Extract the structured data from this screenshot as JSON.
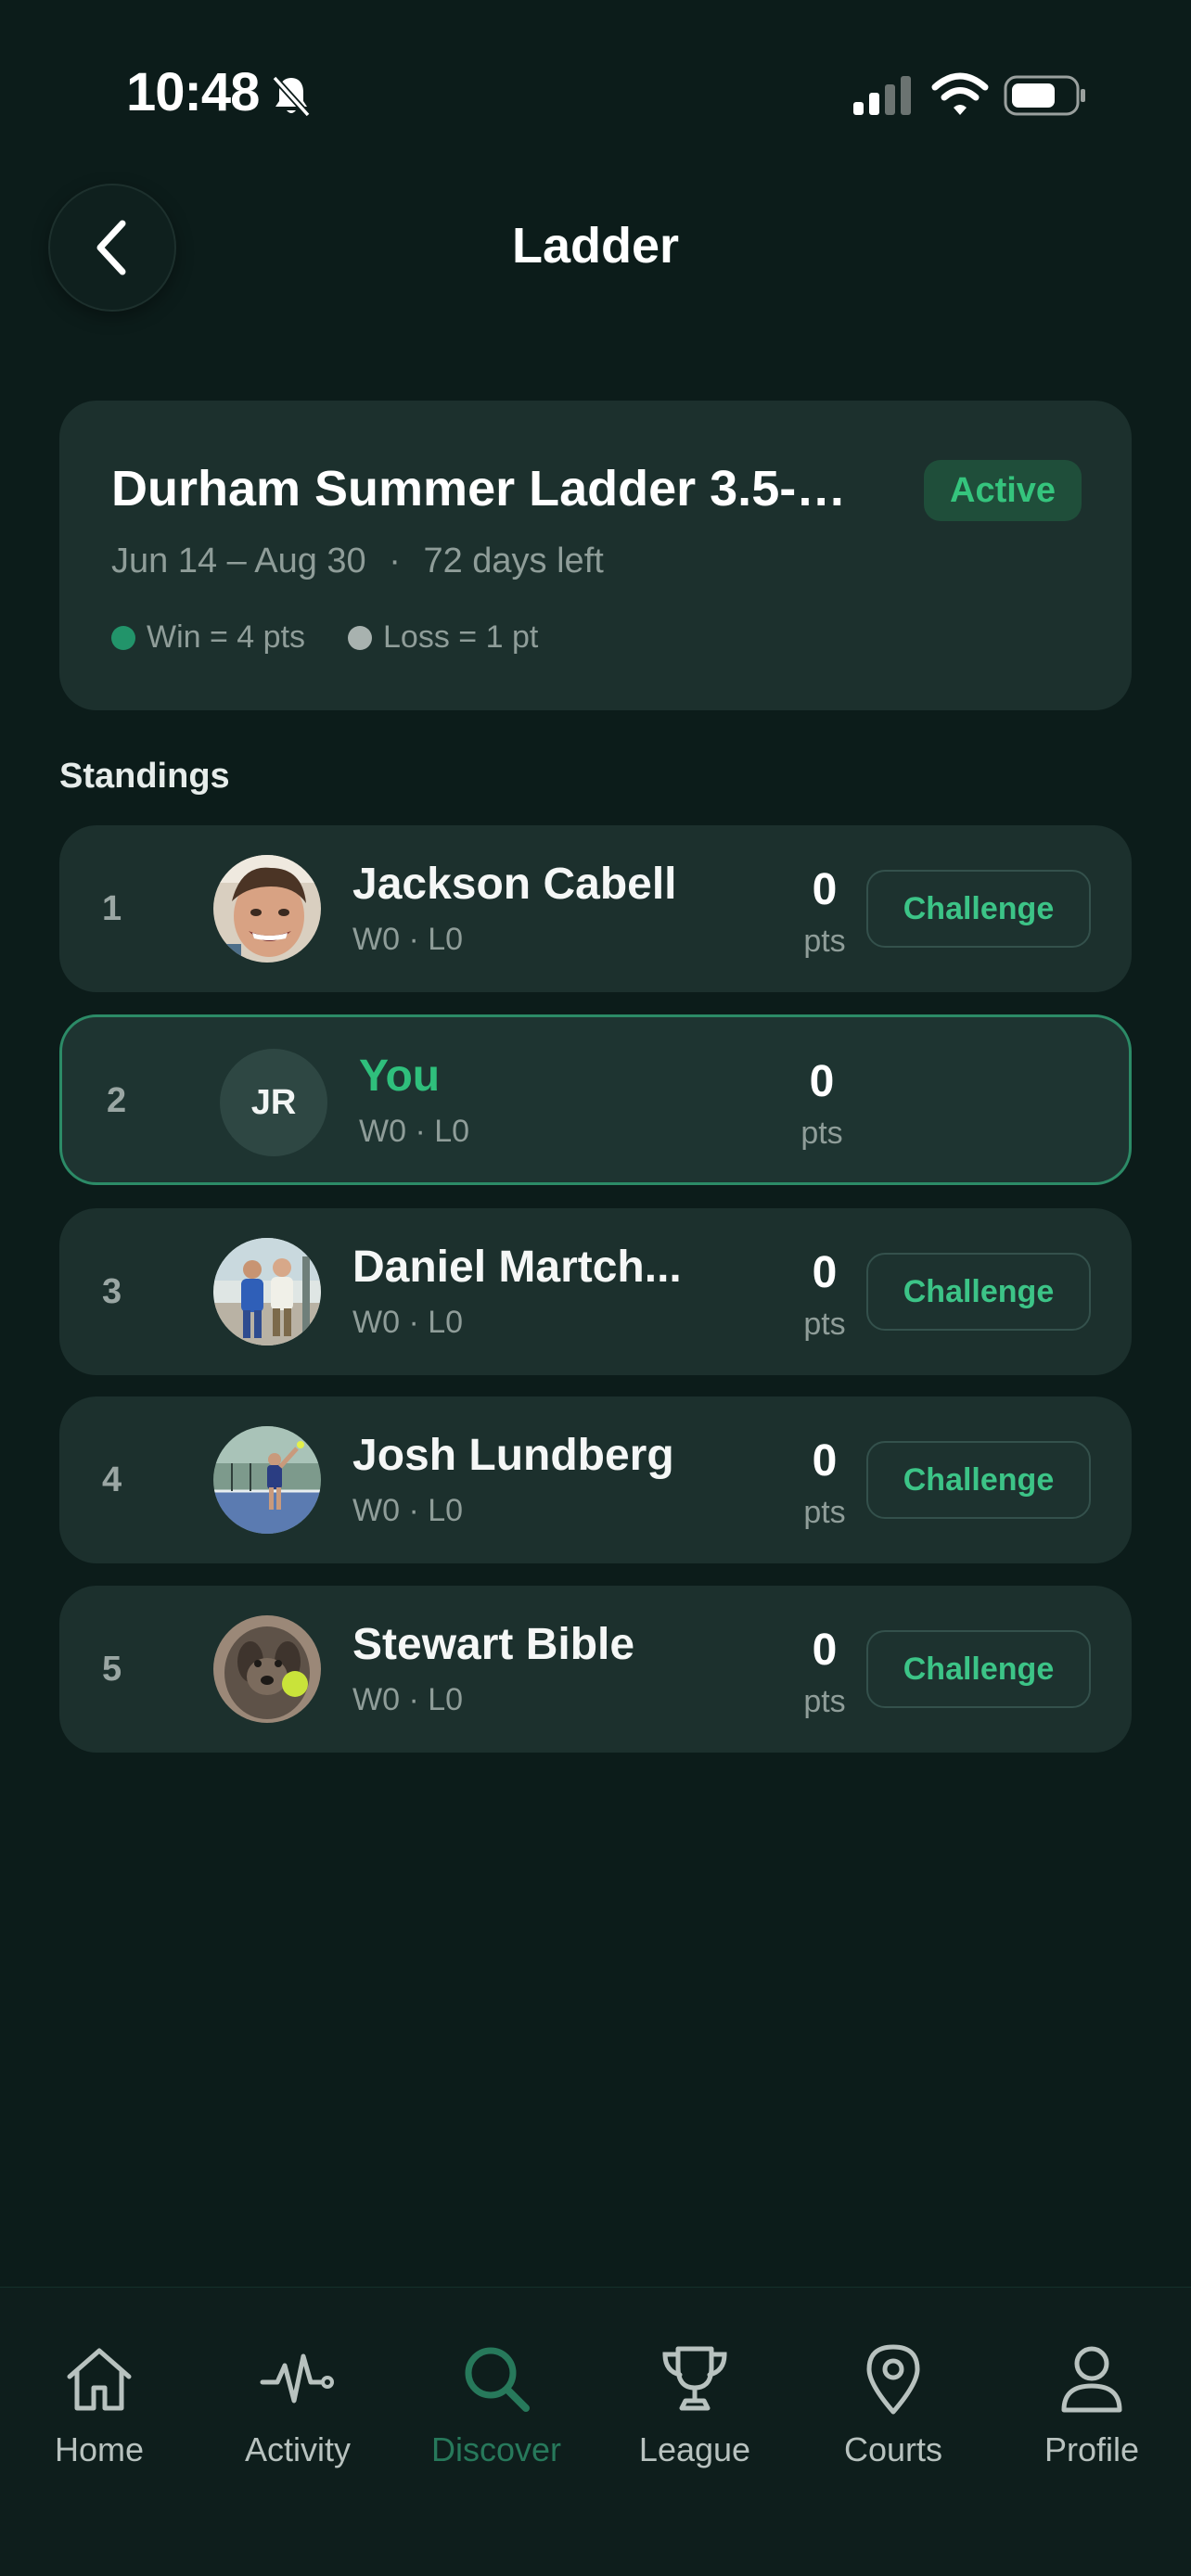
{
  "status_bar": {
    "time": "10:48"
  },
  "header": {
    "title": "Ladder"
  },
  "ladder": {
    "name": "Durham Summer Ladder 3.5-…",
    "status": "Active",
    "dates": "Jun 14 – Aug 30",
    "separator": "·",
    "days_left": "72 days left",
    "win_rule": "Win = 4 pts",
    "loss_rule": "Loss = 1 pt"
  },
  "standings": {
    "label": "Standings",
    "rows": [
      {
        "rank": "1",
        "name": "Jackson Cabell",
        "record": "W0 · L0",
        "points": "0",
        "unit": "pts",
        "action": "Challenge"
      },
      {
        "rank": "2",
        "name": "You",
        "initials": "JR",
        "record": "W0 · L0",
        "points": "0",
        "unit": "pts"
      },
      {
        "rank": "3",
        "name": "Daniel Martch...",
        "record": "W0 · L0",
        "points": "0",
        "unit": "pts",
        "action": "Challenge"
      },
      {
        "rank": "4",
        "name": "Josh Lundberg",
        "record": "W0 · L0",
        "points": "0",
        "unit": "pts",
        "action": "Challenge"
      },
      {
        "rank": "5",
        "name": "Stewart Bible",
        "record": "W0 · L0",
        "points": "0",
        "unit": "pts",
        "action": "Challenge"
      }
    ]
  },
  "tabs": [
    {
      "label": "Home",
      "icon": "home-icon"
    },
    {
      "label": "Activity",
      "icon": "activity-icon"
    },
    {
      "label": "Discover",
      "icon": "search-icon",
      "active": true
    },
    {
      "label": "League",
      "icon": "trophy-icon"
    },
    {
      "label": "Courts",
      "icon": "map-pin-icon"
    },
    {
      "label": "Profile",
      "icon": "person-icon"
    }
  ],
  "colors": {
    "background": "#0c1c1a",
    "card": "#1c302d",
    "accent": "#35c47d",
    "active_tab": "#27795b"
  }
}
